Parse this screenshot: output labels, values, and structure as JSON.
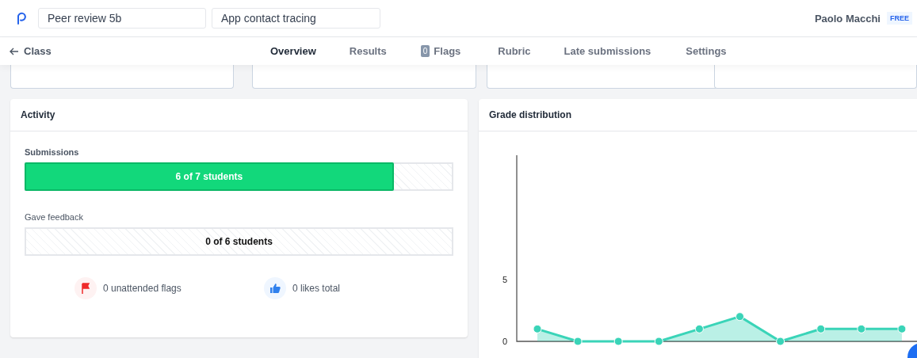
{
  "header": {
    "fields": [
      {
        "value": "Peer review 5b"
      },
      {
        "value": "App contact tracing"
      }
    ],
    "user": "Paolo Macchi",
    "plan_badge": "FREE"
  },
  "nav": {
    "back": "Class",
    "tabs": [
      {
        "label": "Overview",
        "selected": true
      },
      {
        "label": "Results",
        "selected": false
      },
      {
        "label": "Flags",
        "selected": false,
        "count": "0"
      },
      {
        "label": "Rubric",
        "selected": false
      },
      {
        "label": "Late submissions",
        "selected": false
      },
      {
        "label": "Settings",
        "selected": false
      }
    ]
  },
  "activity": {
    "title": "Activity",
    "progress": [
      {
        "label": "Submissions",
        "level": 0.86,
        "reading": "6 of 7 students"
      },
      {
        "label": "Gave feedback",
        "reading": "0 of 6 students"
      }
    ],
    "stats": [
      {
        "kind": "flags",
        "text": "0 unattended flags"
      },
      {
        "kind": "likes",
        "text": "0 likes total"
      }
    ]
  },
  "grade_distribution": {
    "title": "Grade distribution",
    "chart_data": {
      "type": "area",
      "values": [
        1,
        0,
        0,
        0,
        1,
        2,
        0,
        1,
        1,
        1
      ],
      "ylim": [
        0,
        15
      ],
      "yticks": [
        0,
        5
      ]
    }
  }
}
